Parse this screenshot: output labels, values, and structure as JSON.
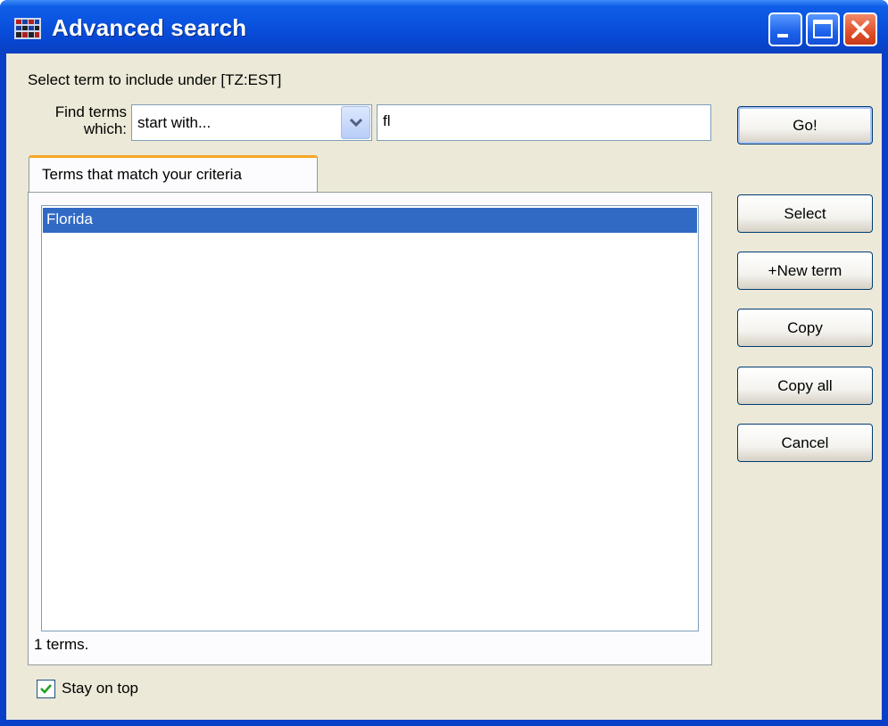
{
  "window": {
    "title": "Advanced search"
  },
  "header": {
    "instruction": "Select term to include under [TZ:EST]"
  },
  "search": {
    "find_label_line1": "Find terms",
    "find_label_line2": "which:",
    "mode_selected": "start with...",
    "query_value": "fl"
  },
  "buttons": {
    "go": "Go!",
    "select": "Select",
    "new_term": "+New term",
    "copy": "Copy",
    "copy_all": "Copy all",
    "cancel": "Cancel"
  },
  "results": {
    "tab_label": "Terms that match your criteria",
    "items": [
      "Florida"
    ],
    "count_text": "1 terms."
  },
  "options": {
    "stay_on_top_label": "Stay on top",
    "stay_on_top_checked": true
  },
  "colors": {
    "selection": "#316ac5",
    "titlebar": "#0a54e0",
    "tab_accent": "#f5a623"
  }
}
